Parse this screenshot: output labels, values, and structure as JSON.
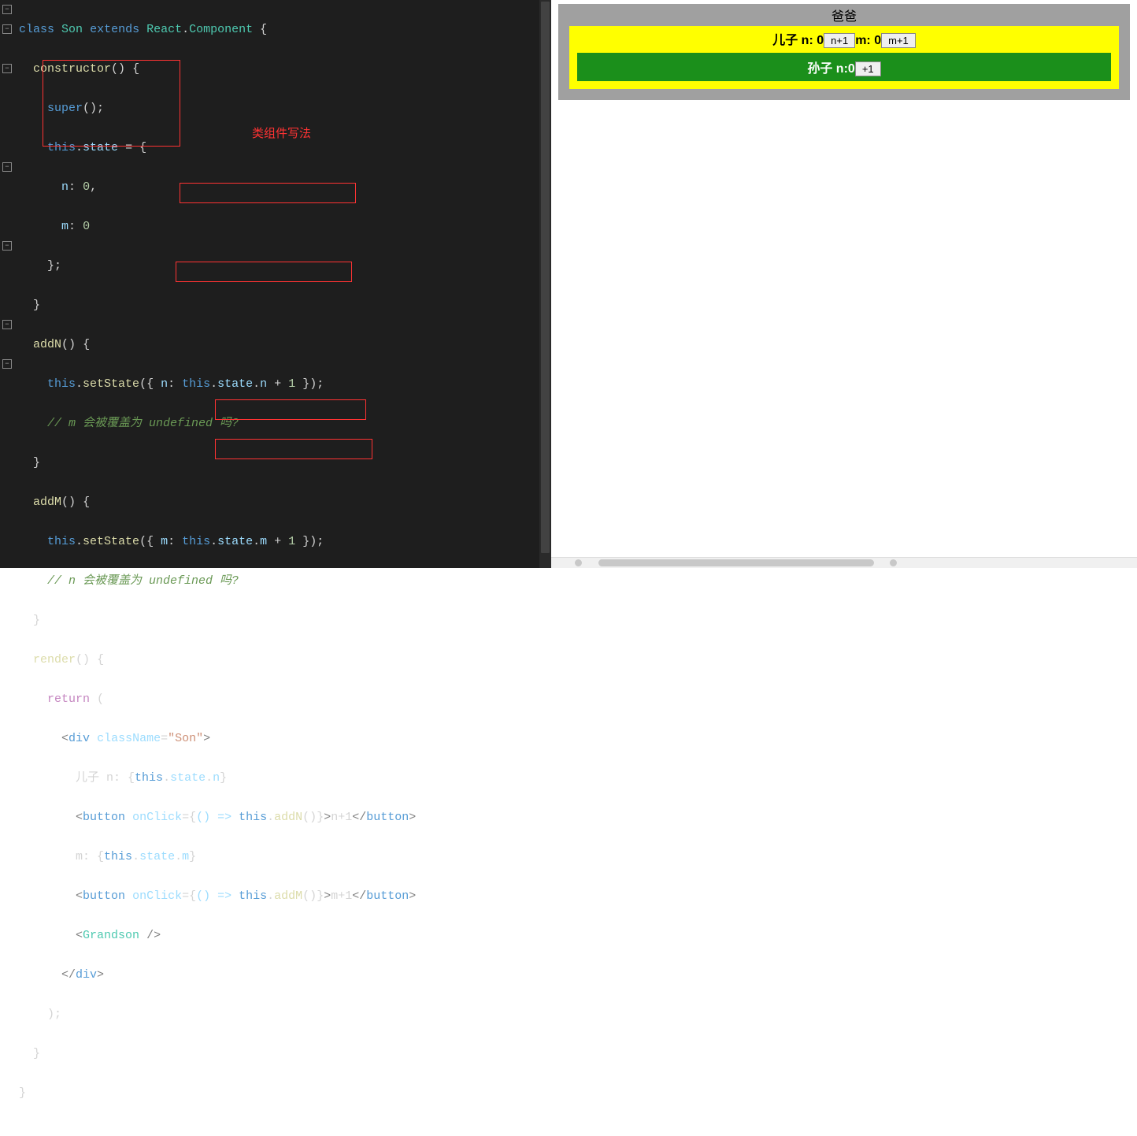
{
  "code": {
    "annotation_label": "类组件写法",
    "line1": {
      "keyword_class": "class",
      "name": "Son",
      "keyword_extends": "extends",
      "react": "React",
      "dot": ".",
      "component": "Component",
      "brace": "{"
    },
    "line2": {
      "fn": "constructor",
      "parens": "()",
      "brace": "{"
    },
    "line3": {
      "super": "super",
      "parens": "()",
      "semi": ";"
    },
    "line4": {
      "this": "this",
      "dot": ".",
      "state": "state",
      "eq": "=",
      "brace": "{"
    },
    "line5": {
      "key": "n",
      "colon": ":",
      "val": "0",
      "comma": ","
    },
    "line6": {
      "key": "m",
      "colon": ":",
      "val": "0"
    },
    "line7": {
      "brace": "}",
      "semi": ";"
    },
    "line8": {
      "brace": "}"
    },
    "line9": {
      "fn": "addN",
      "parens": "()",
      "brace": "{"
    },
    "line10": {
      "this1": "this",
      "dot1": ".",
      "setstate": "setState",
      "paren_open": "({ ",
      "key": "n",
      "colon": ": ",
      "this2": "this",
      "dot2": ".",
      "state": "state",
      "dot3": ".",
      "prop": "n",
      "plus": " + ",
      "one": "1",
      "paren_close": " })",
      "semi": ";"
    },
    "line11": {
      "comment": "// m 会被覆盖为 undefined 吗?"
    },
    "line12": {
      "brace": "}"
    },
    "line13": {
      "fn": "addM",
      "parens": "()",
      "brace": "{"
    },
    "line14": {
      "this1": "this",
      "dot1": ".",
      "setstate": "setState",
      "paren_open": "({ ",
      "key": "m",
      "colon": ": ",
      "this2": "this",
      "dot2": ".",
      "state": "state",
      "dot3": ".",
      "prop": "m",
      "plus": " + ",
      "one": "1",
      "paren_close": " })",
      "semi": ";"
    },
    "line15": {
      "comment": "// n 会被覆盖为 undefined 吗?"
    },
    "line16": {
      "brace": "}"
    },
    "line17": {
      "fn": "render",
      "parens": "()",
      "brace": "{"
    },
    "line18": {
      "return": "return",
      "paren": "("
    },
    "line19": {
      "lt": "<",
      "div": "div",
      "sp": " ",
      "attr": "className",
      "eq": "=",
      "val": "\"Son\"",
      "gt": ">"
    },
    "line20": {
      "text": "儿子 n: ",
      "brace_o": "{",
      "this": "this",
      "dot1": ".",
      "state": "state",
      "dot2": ".",
      "n": "n",
      "brace_c": "}"
    },
    "line21": {
      "lt": "<",
      "btn": "button",
      "sp": " ",
      "attr": "onClick",
      "eq": "=",
      "brace_o": "{",
      "arrow": "() => ",
      "this": "this",
      "dot": ".",
      "fn": "addN",
      "parens": "()",
      "brace_c": "}",
      "gt": ">",
      "txt": "n+1",
      "lt2": "</",
      "btn2": "button",
      "gt2": ">"
    },
    "line22": {
      "text": "m: ",
      "brace_o": "{",
      "this": "this",
      "dot1": ".",
      "state": "state",
      "dot2": ".",
      "m": "m",
      "brace_c": "}"
    },
    "line23": {
      "lt": "<",
      "btn": "button",
      "sp": " ",
      "attr": "onClick",
      "eq": "=",
      "brace_o": "{",
      "arrow": "() => ",
      "this": "this",
      "dot": ".",
      "fn": "addM",
      "parens": "()",
      "brace_c": "}",
      "gt": ">",
      "txt": "m+1",
      "lt2": "</",
      "btn2": "button",
      "gt2": ">"
    },
    "line24": {
      "lt": "<",
      "name": "Grandson",
      "sp": " ",
      "close": "/>"
    },
    "line25": {
      "lt": "</",
      "div": "div",
      "gt": ">"
    },
    "line26": {
      "paren": ")",
      "semi": ";"
    },
    "line27": {
      "brace": "}"
    },
    "line28": {
      "brace": "}"
    }
  },
  "preview": {
    "dad_label": "爸爸",
    "son_prefix": "儿子 n: ",
    "son_n_val": "0",
    "btn_n": "n+1",
    "son_m_prefix": "m: ",
    "son_m_val": "0",
    "btn_m": "m+1",
    "grandson_prefix": "孙子 n:",
    "grandson_val": "0",
    "btn_g": "+1"
  }
}
